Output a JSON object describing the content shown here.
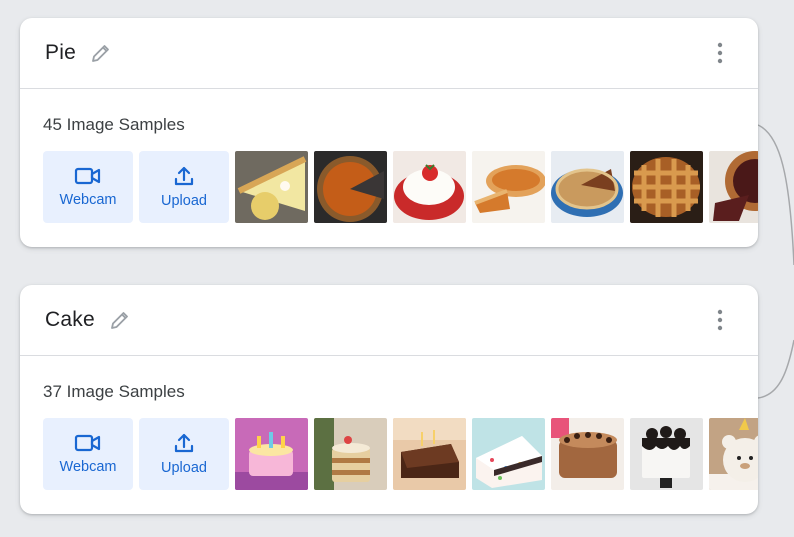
{
  "colors": {
    "background": "#e8eaed",
    "card": "#ffffff",
    "action_button_bg": "#e8f0fe",
    "action_button_text": "#1967d2",
    "connector": "#a6a8ab"
  },
  "classes": [
    {
      "name": "Pie",
      "sample_count_label": "45 Image Samples",
      "webcam_label": "Webcam",
      "upload_label": "Upload",
      "edit_icon": "pencil-icon",
      "menu_icon": "more-vert-icon",
      "samples": [
        "lemon-pie-photo",
        "pumpkin-pie-photo",
        "strawberry-cream-pie-photo",
        "pumpkin-pie-slice-photo",
        "apple-pie-dish-photo",
        "lattice-apple-pie-photo",
        "cherry-pie-photo"
      ]
    },
    {
      "name": "Cake",
      "sample_count_label": "37 Image Samples",
      "webcam_label": "Webcam",
      "upload_label": "Upload",
      "edit_icon": "pencil-icon",
      "menu_icon": "more-vert-icon",
      "samples": [
        "pink-birthday-cake-photo",
        "layer-cake-candles-photo",
        "chocolate-sheet-cake-photo",
        "funfetti-cake-photo",
        "chocolate-mousse-cake-photo",
        "oreo-drip-cake-photo",
        "bear-cake-photo"
      ]
    }
  ]
}
